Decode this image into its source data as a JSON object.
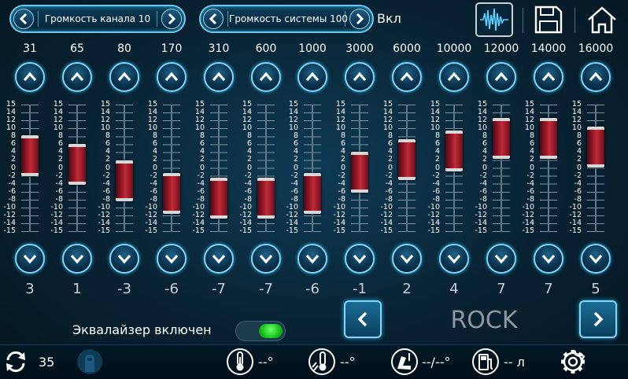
{
  "header": {
    "channel_volume_label": "Громкость канала 10",
    "system_volume_label": "Громкость системы 100",
    "system_state": "Вкл",
    "icons": [
      "equalizer-icon",
      "save-icon",
      "home-icon"
    ]
  },
  "equalizer": {
    "scale": [
      "15",
      "14",
      "12",
      "10",
      "8",
      "6",
      "4",
      "2",
      "0",
      "-2",
      "-4",
      "-6",
      "-8",
      "-10",
      "-12",
      "-14",
      "-15"
    ],
    "range": [
      -15,
      15
    ],
    "bands": [
      {
        "freq": "31",
        "gain": "3"
      },
      {
        "freq": "65",
        "gain": "1"
      },
      {
        "freq": "80",
        "gain": "-3"
      },
      {
        "freq": "170",
        "gain": "-6"
      },
      {
        "freq": "310",
        "gain": "-7"
      },
      {
        "freq": "600",
        "gain": "-7"
      },
      {
        "freq": "1000",
        "gain": "-6"
      },
      {
        "freq": "3000",
        "gain": "-1"
      },
      {
        "freq": "6000",
        "gain": "2"
      },
      {
        "freq": "10000",
        "gain": "4"
      },
      {
        "freq": "12000",
        "gain": "7"
      },
      {
        "freq": "14000",
        "gain": "7"
      },
      {
        "freq": "16000",
        "gain": "5"
      }
    ],
    "enabled_label": "Эквалайзер включен",
    "enabled": true,
    "preset": "ROCK"
  },
  "status_bar": {
    "sync_value": "35",
    "temp_outside": "--°",
    "temp_inside": "--°",
    "seat_temps": "--/--°",
    "fuel": "-- л"
  },
  "colors": {
    "accent": "#7fd4f5",
    "slider_thumb": "#a81c2c",
    "toggle_on": "#22c922"
  }
}
